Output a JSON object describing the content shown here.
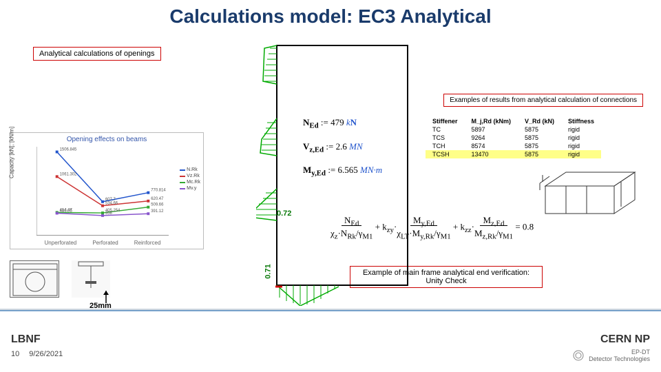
{
  "title": "Calculations model: EC3 Analytical",
  "labels": {
    "openings": "Analytical calculations of openings",
    "examples": "Examples of results from analytical calculation of connections",
    "unity": "Example of main frame analytical end verification: Unity Check",
    "mm25": "25mm"
  },
  "chart": {
    "title": "Opening effects on beams",
    "ylabel": "Capacity [kN], [kN/m]",
    "categories": [
      "Unperforated",
      "Perforated",
      "Reinforced"
    ],
    "series": [
      {
        "name": "N.Rk",
        "color": "#2255cc",
        "values": [
          1506.845,
          607.7,
          770.814
        ]
      },
      {
        "name": "Vz.Rk",
        "color": "#cc3333",
        "values": [
          1061.302,
          534.66,
          620.47
        ]
      },
      {
        "name": "Mc.Rk",
        "color": "#33aa33",
        "values": [
          414.47,
          405.254,
          509.66
        ]
      },
      {
        "name": "Mv.y",
        "color": "#8855cc",
        "values": [
          400.05,
          358,
          391.12
        ]
      }
    ]
  },
  "formulas": {
    "n": "N_Ed := 479 kN",
    "v": "V_z,Ed := 2.6 MN",
    "m": "M_y,Ed := 6.565 MN·m",
    "unity": "N_Ed/(χ_z·N_Rk/γ_M1) + k_zy·M_y,Ed/(χ_LT·M_y,Rk/γ_M1) + k_zz·M_z,Ed/(M_z,Rk/γ_M1) = 0.8"
  },
  "greens": {
    "a": "0.72",
    "b": "0.71"
  },
  "results_table": {
    "headers": [
      "Stiffener",
      "M_j,Rd (kNm)",
      "V_Rd (kN)",
      "Stiffness"
    ],
    "rows": [
      [
        "TC",
        "5897",
        "5875",
        "rigid"
      ],
      [
        "TCS",
        "9264",
        "5875",
        "rigid"
      ],
      [
        "TCH",
        "8574",
        "5875",
        "rigid"
      ],
      [
        "TCSH",
        "13470",
        "5875",
        "rigid"
      ]
    ],
    "highlight_row": 3
  },
  "chart_data": {
    "type": "line",
    "title": "Opening effects on beams",
    "xlabel": "",
    "ylabel": "Capacity [kN], [kN/m]",
    "categories": [
      "Unperforated",
      "Perforated",
      "Reinforced"
    ],
    "series": [
      {
        "name": "N.Rk",
        "values": [
          1506.845,
          607.7,
          770.814
        ]
      },
      {
        "name": "Vz.Rk",
        "values": [
          1061.302,
          534.66,
          620.47
        ]
      },
      {
        "name": "Mc.Rk",
        "values": [
          414.47,
          405.254,
          509.66
        ]
      },
      {
        "name": "Mv.y",
        "values": [
          400.05,
          358,
          391.12
        ]
      }
    ],
    "ylim": [
      0,
      1600
    ]
  },
  "footer": {
    "left": "LBNF",
    "page": "10",
    "date": "9/26/2021",
    "right": "CERN NP",
    "sub1": "EP-DT",
    "sub2": "Detector Technologies"
  }
}
